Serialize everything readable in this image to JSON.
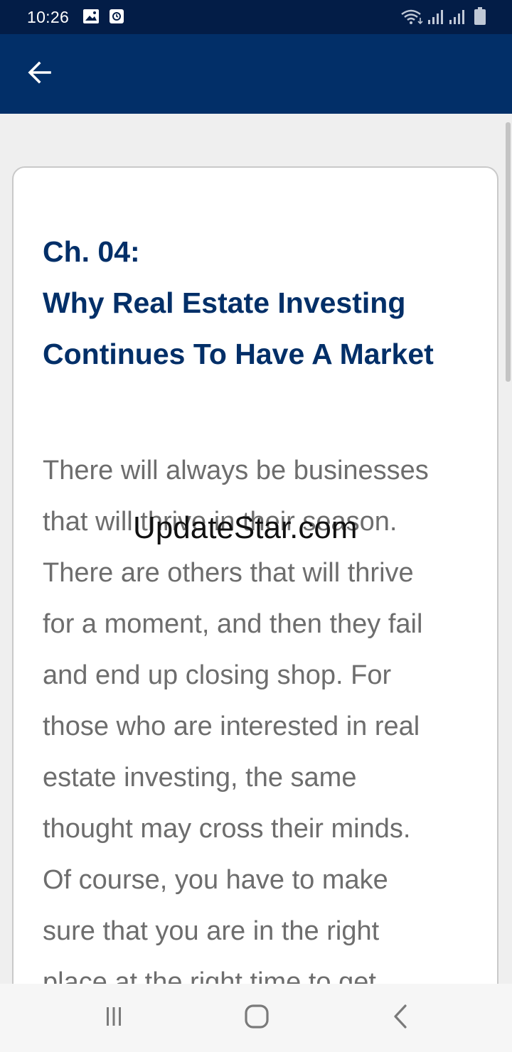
{
  "status_bar": {
    "time": "10:26",
    "left_icons": [
      "image-notification-icon",
      "screen-record-icon"
    ],
    "right_icons": [
      "wifi-icon",
      "signal-icon-1",
      "signal-icon-2",
      "battery-icon"
    ]
  },
  "app_bar": {
    "back_icon": "arrow-left-icon",
    "background": "#022f68"
  },
  "chapter": {
    "number": "Ch. 04:",
    "title_line1": "Why Real Estate Investing",
    "title_line2": "Continues To Have A Market",
    "color": "#022f68"
  },
  "body": {
    "lines": [
      "There will always be businesses",
      "that will thrive in their season.",
      "There are others that will thrive",
      "for a moment, and then they fail",
      "and end up closing shop. For",
      "those who are interested in real",
      "estate investing, the same",
      "thought may cross their minds.",
      "Of course, you have to make",
      "sure that you are in the right",
      "place at the right time to get"
    ]
  },
  "watermark": {
    "text": "UpdateStar.com"
  },
  "nav_bar": {
    "icons": [
      "recent-apps-icon",
      "home-icon",
      "back-icon"
    ]
  }
}
